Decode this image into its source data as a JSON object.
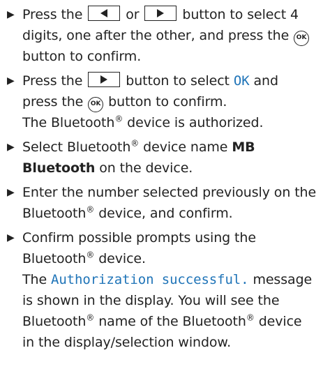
{
  "steps": [
    {
      "parts": [
        "Press the",
        "or",
        "button to select 4 digits, one after the other, and press the",
        "button to confirm."
      ]
    },
    {
      "parts": [
        "Press the",
        "button to select",
        "OK",
        "and press the",
        "button to confirm."
      ],
      "result": "The Bluetooth",
      "result_end": "device is authorized."
    },
    {
      "parts": [
        "Select Bluetooth",
        "device name",
        "MB Bluetooth",
        "on the device."
      ]
    },
    {
      "parts": [
        "Enter the number selected previously on the Bluetooth",
        "device, and confirm."
      ]
    },
    {
      "parts": [
        "Confirm possible prompts using the Bluetooth",
        "device."
      ],
      "result_prefix": "The",
      "result_display": "Authorization successful.",
      "result_middle": "message is shown in the display. You will see the Bluetooth",
      "result_middle2": "name of the Bluetooth",
      "result_end": "device in the display/selection window."
    }
  ],
  "symbols": {
    "bullet": "▶",
    "ok_label": "OK",
    "registered": "®"
  },
  "colors": {
    "display_text": "#1f74b8",
    "body_text": "#222222"
  }
}
